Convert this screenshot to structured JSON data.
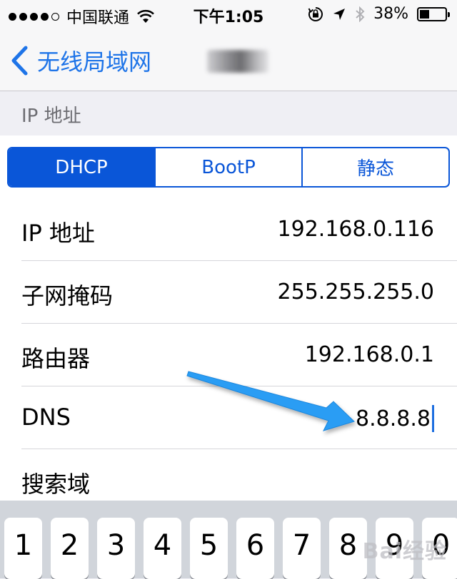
{
  "status_bar": {
    "carrier": "中国联通",
    "time": "下午1:05",
    "battery_percent": "38%",
    "battery_level": 0.38,
    "signal_bars_filled": 4,
    "signal_bars_total": 5,
    "icons": [
      "signal-dots-icon",
      "wifi-icon",
      "orientation-lock-icon",
      "location-arrow-icon",
      "bluetooth-icon",
      "battery-icon"
    ]
  },
  "nav": {
    "back_label": "无线局域网",
    "back_icon": "chevron-left-icon"
  },
  "section": {
    "header": "IP 地址"
  },
  "segments": {
    "items": [
      "DHCP",
      "BootP",
      "静态"
    ],
    "selected": "DHCP"
  },
  "rows": [
    {
      "label": "IP 地址",
      "value": "192.168.0.116"
    },
    {
      "label": "子网掩码",
      "value": "255.255.255.0"
    },
    {
      "label": "路由器",
      "value": "192.168.0.1"
    },
    {
      "label": "DNS",
      "value": "8.8.8.8"
    },
    {
      "label": "搜索域",
      "value": ""
    }
  ],
  "keyboard": {
    "keys": [
      "1",
      "2",
      "3",
      "4",
      "5",
      "6",
      "7",
      "8",
      "9",
      "0"
    ]
  },
  "watermark": "Bai经验",
  "colors": {
    "accent": "#0a56d8",
    "back_text": "#1e74e8",
    "annotation_arrow": "#2a9df4"
  }
}
